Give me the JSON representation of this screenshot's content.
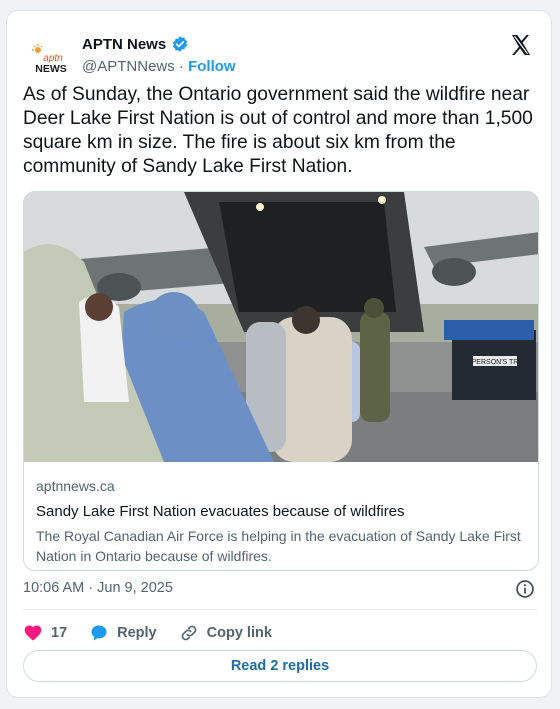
{
  "author": {
    "display_name": "APTN News",
    "handle": "@APTNNews",
    "separator": "·",
    "follow_label": "Follow",
    "avatar_text_top": "aptn",
    "avatar_text_bottom": "NEWS"
  },
  "tweet": {
    "text": "As of Sunday, the Ontario government said the wildfire near Deer Lake First Nation is out of control and more than 1,500 square km in size. The fire is about six km from the community of Sandy Lake First Nation."
  },
  "link_card": {
    "domain": "aptnnews.ca",
    "title": "Sandy Lake First Nation evacuates because of wildfires",
    "description": "The Royal Canadian Air Force is helping in the evacuation of Sandy Lake First Nation in Ontario because of wildfires.",
    "photo_sign_text": "PERSON'S TR"
  },
  "meta": {
    "timestamp": "10:06 AM · Jun 9, 2025"
  },
  "actions": {
    "like_count": "17",
    "reply_label": "Reply",
    "copy_link_label": "Copy link"
  },
  "replies": {
    "label": "Read 2 replies"
  },
  "icons": {
    "verified": "verified-badge-icon",
    "platform": "x-logo-icon",
    "info": "info-icon",
    "like": "heart-icon",
    "reply": "speech-bubble-icon",
    "copy": "link-icon"
  },
  "colors": {
    "accent": "#1d9bf0",
    "like": "#f91880",
    "reply_link": "#1d6ea8",
    "muted_text": "#536471"
  }
}
